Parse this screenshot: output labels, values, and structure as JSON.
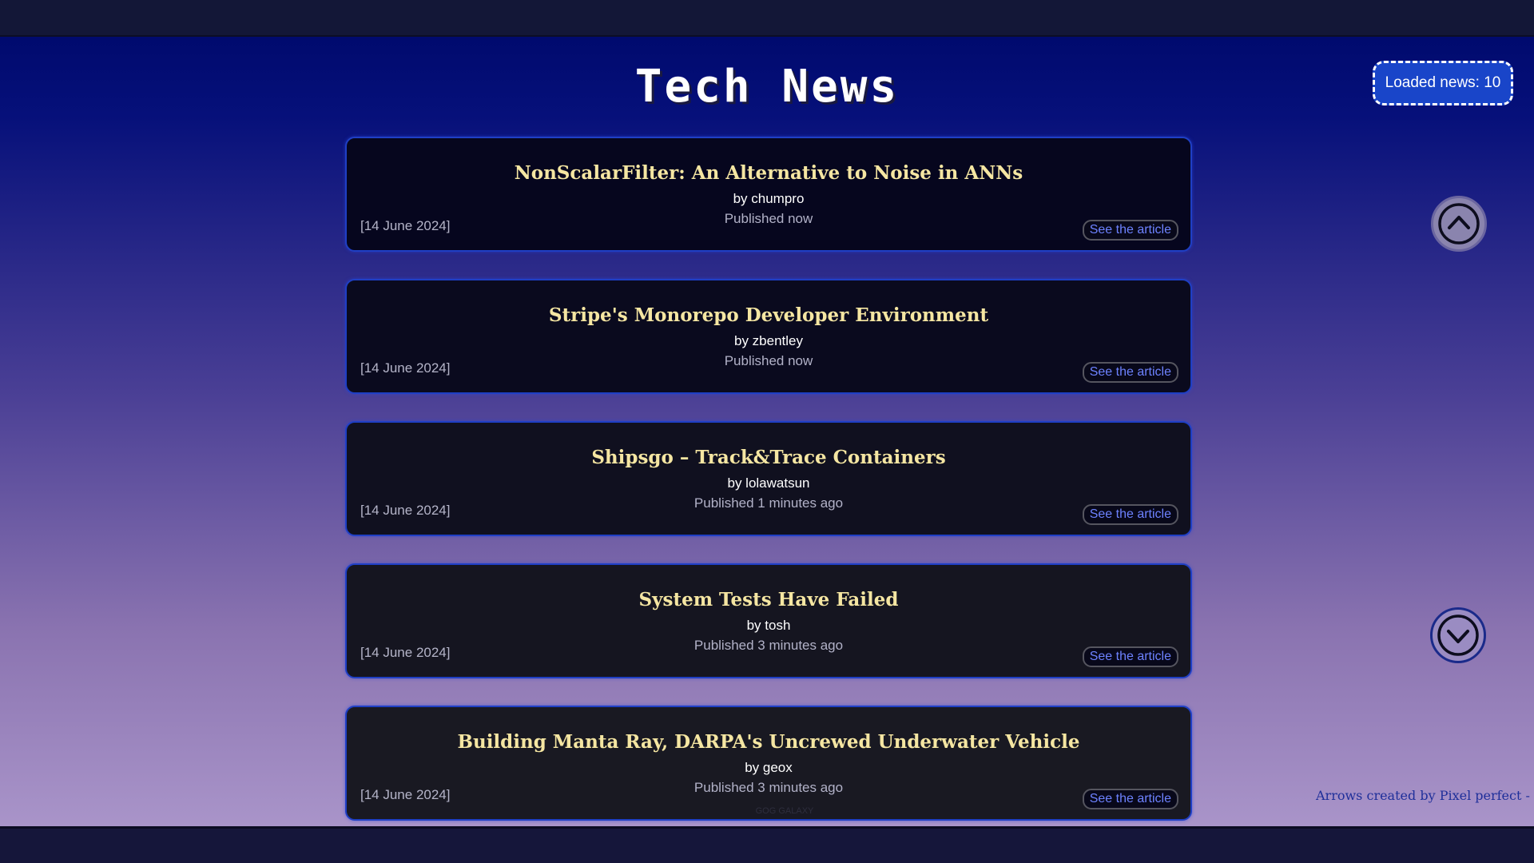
{
  "page": {
    "title": "Tech News",
    "loaded_label": "Loaded news: 10"
  },
  "news": [
    {
      "title": "NonScalarFilter: An Alternative to Noise in ANNs",
      "author": "by chumpro",
      "published": "Published now",
      "date": "[14 June 2024]",
      "link_label": "See the article"
    },
    {
      "title": "Stripe's Monorepo Developer Environment",
      "author": "by zbentley",
      "published": "Published now",
      "date": "[14 June 2024]",
      "link_label": "See the article"
    },
    {
      "title": "Shipsgo – Track&Trace Containers",
      "author": "by lolawatsun",
      "published": "Published 1 minutes ago",
      "date": "[14 June 2024]",
      "link_label": "See the article"
    },
    {
      "title": "System Tests Have Failed",
      "author": "by tosh",
      "published": "Published 3 minutes ago",
      "date": "[14 June 2024]",
      "link_label": "See the article"
    },
    {
      "title": "Building Manta Ray, DARPA's Uncrewed Underwater Vehicle",
      "author": "by geox",
      "published": "Published 3 minutes ago",
      "date": "[14 June 2024]",
      "link_label": "See the article"
    }
  ],
  "watermark": "GOG GALAXY",
  "credit": "Arrows created by Pixel perfect - Flaticon",
  "controls": {
    "scroll_up_icon": "chevron-up-circle-icon",
    "scroll_down_icon": "chevron-down-circle-icon"
  },
  "colors": {
    "title_gold": "#f5e6a2",
    "badge_blue": "#1945c9",
    "link_blue": "#6d82ff",
    "card_border": "#1f3fc4"
  }
}
